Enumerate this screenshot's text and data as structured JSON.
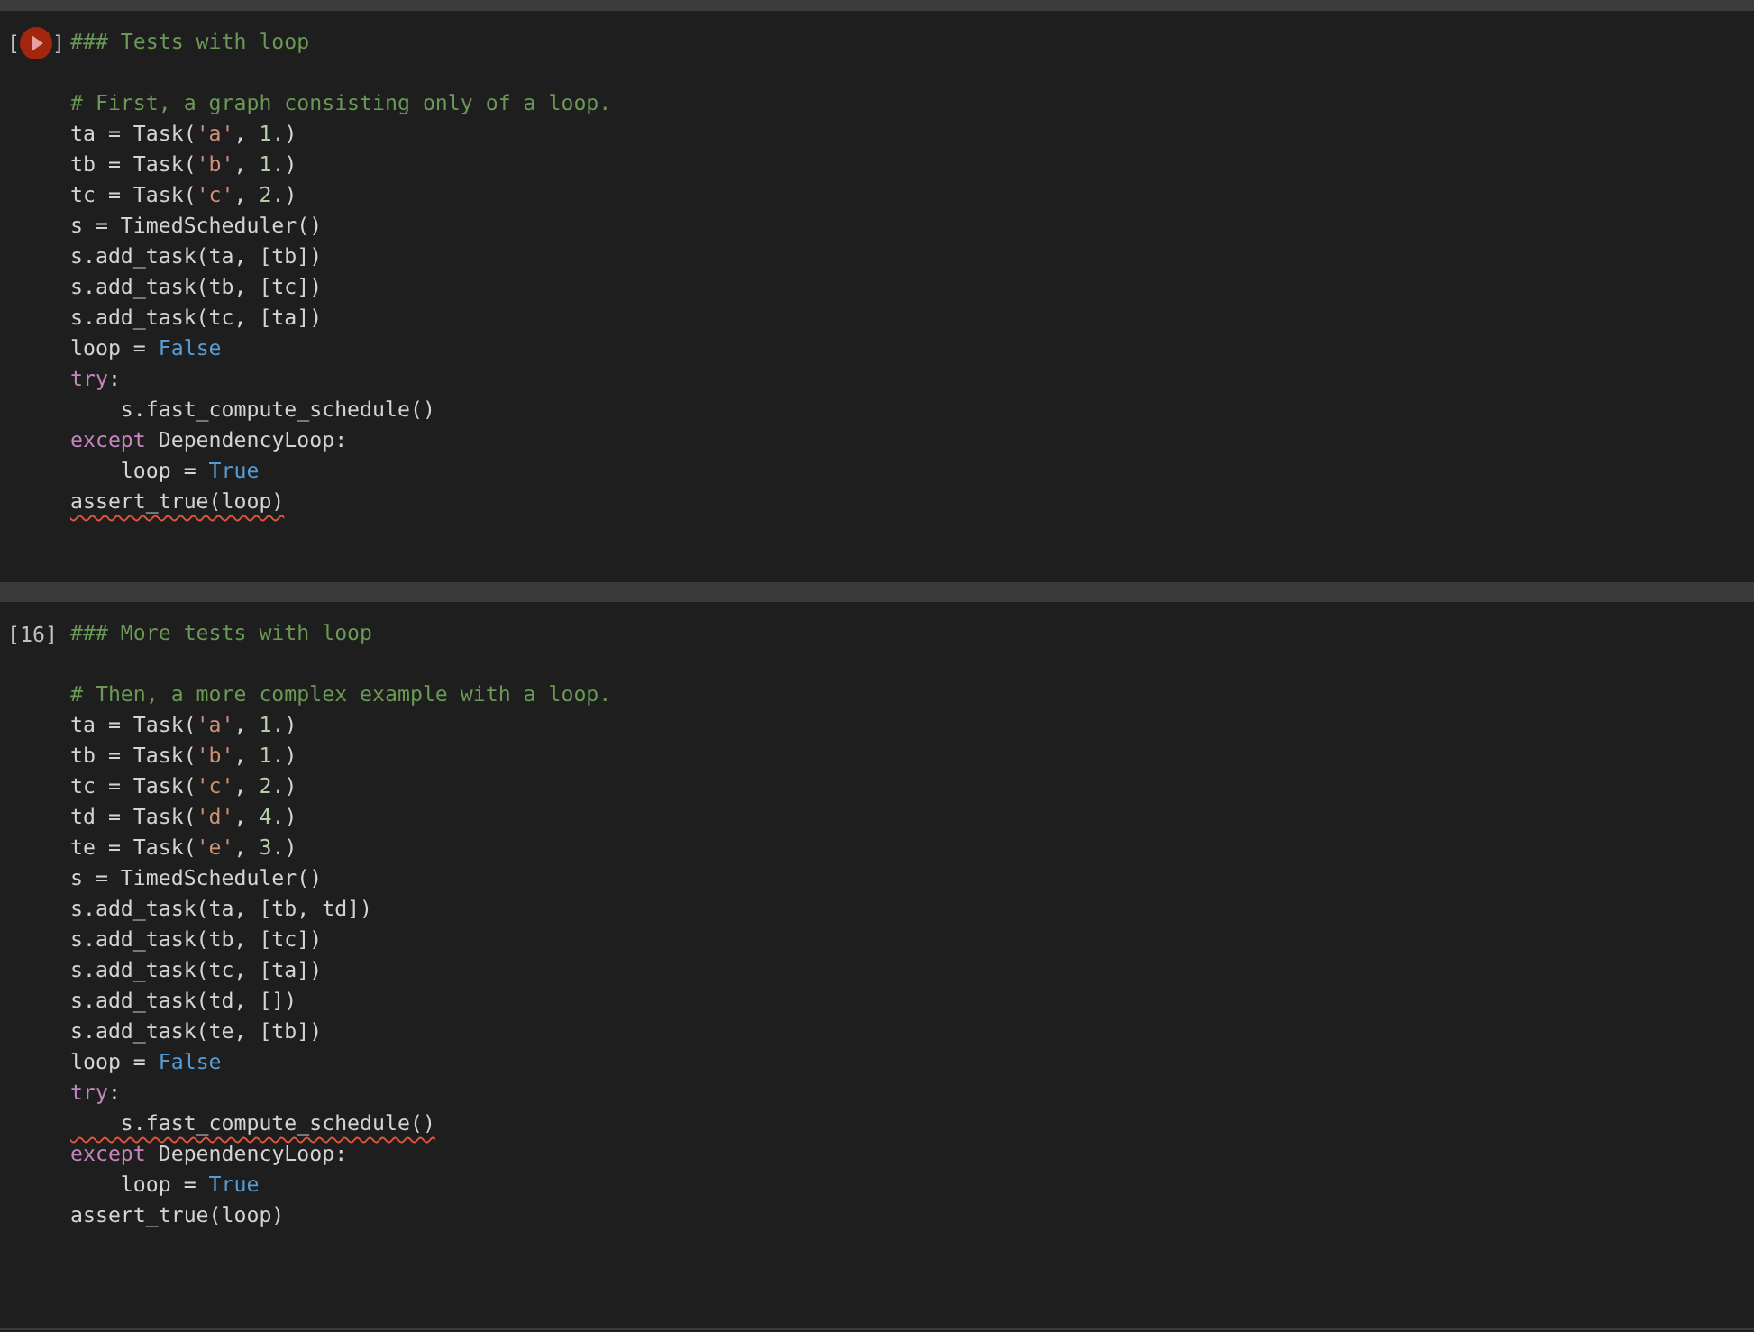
{
  "cells": [
    {
      "prompt_open": "[",
      "prompt_close": "]",
      "running": true,
      "heading": "### Tests with loop",
      "lines": [
        {
          "squiggle": false,
          "tokens": [
            {
              "kind": "comment",
              "text": "# First, a graph consisting only of a loop."
            }
          ]
        },
        {
          "squiggle": false,
          "tokens": [
            {
              "kind": "plain",
              "text": "ta = Task("
            },
            {
              "kind": "string",
              "text": "'a'"
            },
            {
              "kind": "plain",
              "text": ", "
            },
            {
              "kind": "number",
              "text": "1."
            },
            {
              "kind": "plain",
              "text": ")"
            }
          ]
        },
        {
          "squiggle": false,
          "tokens": [
            {
              "kind": "plain",
              "text": "tb = Task("
            },
            {
              "kind": "string",
              "text": "'b'"
            },
            {
              "kind": "plain",
              "text": ", "
            },
            {
              "kind": "number",
              "text": "1."
            },
            {
              "kind": "plain",
              "text": ")"
            }
          ]
        },
        {
          "squiggle": false,
          "tokens": [
            {
              "kind": "plain",
              "text": "tc = Task("
            },
            {
              "kind": "string",
              "text": "'c'"
            },
            {
              "kind": "plain",
              "text": ", "
            },
            {
              "kind": "number",
              "text": "2."
            },
            {
              "kind": "plain",
              "text": ")"
            }
          ]
        },
        {
          "squiggle": false,
          "tokens": [
            {
              "kind": "plain",
              "text": "s = TimedScheduler()"
            }
          ]
        },
        {
          "squiggle": false,
          "tokens": [
            {
              "kind": "plain",
              "text": "s.add_task(ta, [tb])"
            }
          ]
        },
        {
          "squiggle": false,
          "tokens": [
            {
              "kind": "plain",
              "text": "s.add_task(tb, [tc])"
            }
          ]
        },
        {
          "squiggle": false,
          "tokens": [
            {
              "kind": "plain",
              "text": "s.add_task(tc, [ta])"
            }
          ]
        },
        {
          "squiggle": false,
          "tokens": [
            {
              "kind": "plain",
              "text": "loop = "
            },
            {
              "kind": "constant",
              "text": "False"
            }
          ]
        },
        {
          "squiggle": false,
          "tokens": [
            {
              "kind": "keyword",
              "text": "try"
            },
            {
              "kind": "plain",
              "text": ":"
            }
          ]
        },
        {
          "squiggle": false,
          "tokens": [
            {
              "kind": "plain",
              "text": "    s.fast_compute_schedule()"
            }
          ]
        },
        {
          "squiggle": false,
          "tokens": [
            {
              "kind": "keyword",
              "text": "except"
            },
            {
              "kind": "plain",
              "text": " DependencyLoop:"
            }
          ]
        },
        {
          "squiggle": false,
          "tokens": [
            {
              "kind": "plain",
              "text": "    loop = "
            },
            {
              "kind": "constant",
              "text": "True"
            }
          ]
        },
        {
          "squiggle": true,
          "tokens": [
            {
              "kind": "plain",
              "text": "assert_true(loop)"
            }
          ]
        }
      ]
    },
    {
      "prompt_open": "[",
      "count": "16",
      "prompt_close": "]",
      "running": false,
      "heading": "### More tests with loop",
      "lines": [
        {
          "squiggle": false,
          "tokens": [
            {
              "kind": "comment",
              "text": "# Then, a more complex example with a loop."
            }
          ]
        },
        {
          "squiggle": false,
          "tokens": [
            {
              "kind": "plain",
              "text": "ta = Task("
            },
            {
              "kind": "string",
              "text": "'a'"
            },
            {
              "kind": "plain",
              "text": ", "
            },
            {
              "kind": "number",
              "text": "1."
            },
            {
              "kind": "plain",
              "text": ")"
            }
          ]
        },
        {
          "squiggle": false,
          "tokens": [
            {
              "kind": "plain",
              "text": "tb = Task("
            },
            {
              "kind": "string",
              "text": "'b'"
            },
            {
              "kind": "plain",
              "text": ", "
            },
            {
              "kind": "number",
              "text": "1."
            },
            {
              "kind": "plain",
              "text": ")"
            }
          ]
        },
        {
          "squiggle": false,
          "tokens": [
            {
              "kind": "plain",
              "text": "tc = Task("
            },
            {
              "kind": "string",
              "text": "'c'"
            },
            {
              "kind": "plain",
              "text": ", "
            },
            {
              "kind": "number",
              "text": "2."
            },
            {
              "kind": "plain",
              "text": ")"
            }
          ]
        },
        {
          "squiggle": false,
          "tokens": [
            {
              "kind": "plain",
              "text": "td = Task("
            },
            {
              "kind": "string",
              "text": "'d'"
            },
            {
              "kind": "plain",
              "text": ", "
            },
            {
              "kind": "number",
              "text": "4."
            },
            {
              "kind": "plain",
              "text": ")"
            }
          ]
        },
        {
          "squiggle": false,
          "tokens": [
            {
              "kind": "plain",
              "text": "te = Task("
            },
            {
              "kind": "string",
              "text": "'e'"
            },
            {
              "kind": "plain",
              "text": ", "
            },
            {
              "kind": "number",
              "text": "3."
            },
            {
              "kind": "plain",
              "text": ")"
            }
          ]
        },
        {
          "squiggle": false,
          "tokens": [
            {
              "kind": "plain",
              "text": "s = TimedScheduler()"
            }
          ]
        },
        {
          "squiggle": false,
          "tokens": [
            {
              "kind": "plain",
              "text": "s.add_task(ta, [tb, td])"
            }
          ]
        },
        {
          "squiggle": false,
          "tokens": [
            {
              "kind": "plain",
              "text": "s.add_task(tb, [tc])"
            }
          ]
        },
        {
          "squiggle": false,
          "tokens": [
            {
              "kind": "plain",
              "text": "s.add_task(tc, [ta])"
            }
          ]
        },
        {
          "squiggle": false,
          "tokens": [
            {
              "kind": "plain",
              "text": "s.add_task(td, [])"
            }
          ]
        },
        {
          "squiggle": false,
          "tokens": [
            {
              "kind": "plain",
              "text": "s.add_task(te, [tb])"
            }
          ]
        },
        {
          "squiggle": false,
          "tokens": [
            {
              "kind": "plain",
              "text": "loop = "
            },
            {
              "kind": "constant",
              "text": "False"
            }
          ]
        },
        {
          "squiggle": false,
          "tokens": [
            {
              "kind": "keyword",
              "text": "try"
            },
            {
              "kind": "plain",
              "text": ":"
            }
          ]
        },
        {
          "squiggle": true,
          "tokens": [
            {
              "kind": "plain",
              "text": "    s.fast_compute_schedule()"
            }
          ]
        },
        {
          "squiggle": false,
          "tokens": [
            {
              "kind": "keyword",
              "text": "except"
            },
            {
              "kind": "plain",
              "text": " DependencyLoop:"
            }
          ]
        },
        {
          "squiggle": false,
          "tokens": [
            {
              "kind": "plain",
              "text": "    loop = "
            },
            {
              "kind": "constant",
              "text": "True"
            }
          ]
        },
        {
          "squiggle": false,
          "tokens": [
            {
              "kind": "plain",
              "text": "assert_true(loop)"
            }
          ]
        }
      ]
    }
  ]
}
